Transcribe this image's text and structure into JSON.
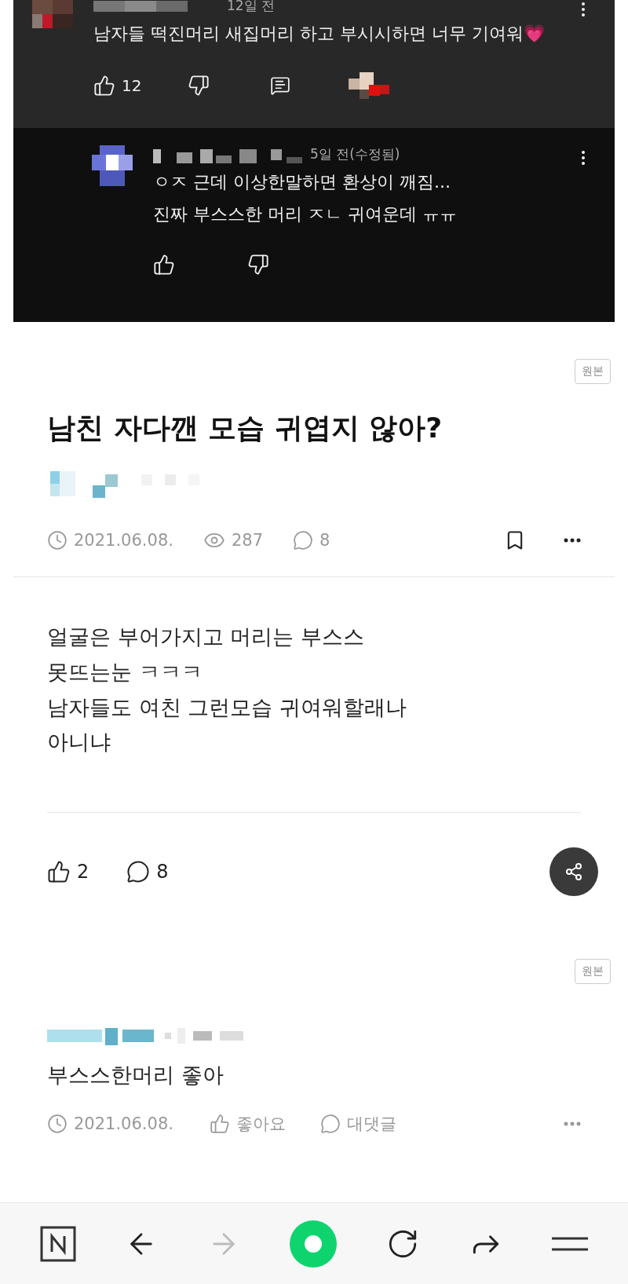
{
  "embedded_comments": {
    "comment": {
      "time": "12일 전",
      "text": "남자들 떡진머리 새집머리 하고 부시시하면 너무 기여워💗",
      "likes": "12"
    },
    "reply": {
      "time": "5일 전(수정됨)",
      "lines": [
        "ㅇㅈ 근데 이상한말하면 환상이 깨짐...",
        "진짜 부스스한 머리 ㅈㄴ 귀여운데 ㅠㅠ"
      ]
    }
  },
  "post": {
    "original_badge": "원본",
    "title": "남친 자다깬 모습 귀엽지 않아?",
    "date": "2021.06.08.",
    "views": "287",
    "comments": "8",
    "bookmarked": false,
    "body": [
      "얼굴은 부어가지고 머리는 부스스",
      "못뜨는눈 ㅋㅋㅋ",
      "남자들도 여친 그런모습 귀여워할래나",
      "아니냐"
    ],
    "likes": "2",
    "comment_count": "8"
  },
  "reply_comment": {
    "original_badge": "원본",
    "text": "부스스한머리 좋아",
    "date": "2021.06.08.",
    "like_label": "좋아요",
    "reply_label": "대댓글"
  }
}
